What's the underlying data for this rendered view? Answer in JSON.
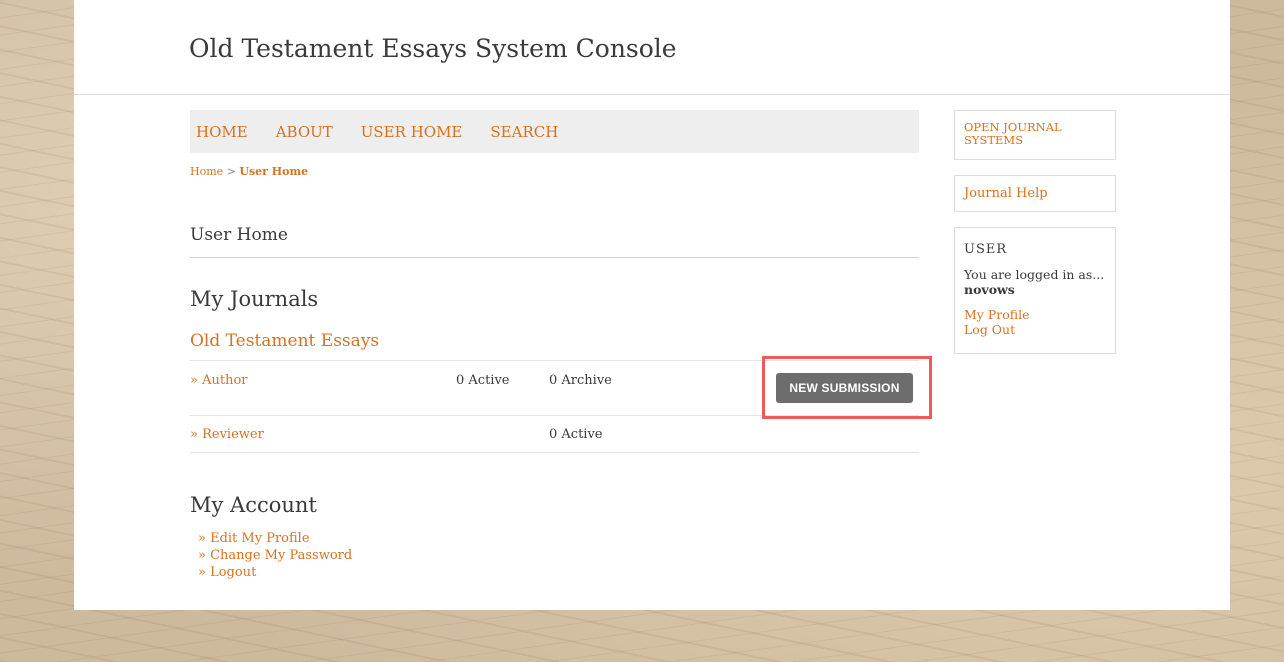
{
  "header": {
    "site_title": "Old Testament Essays System Console"
  },
  "nav": {
    "items": [
      "HOME",
      "ABOUT",
      "USER HOME",
      "SEARCH"
    ]
  },
  "breadcrumb": {
    "home": "Home",
    "separator": ">",
    "current": "User Home"
  },
  "page_title": "User Home",
  "my_journals": {
    "title": "My Journals",
    "journal_name": "Old Testament Essays",
    "roles": [
      {
        "label": "» Author",
        "active": "0 Active",
        "archive": "0 Archive",
        "action": "NEW SUBMISSION"
      },
      {
        "label": "» Reviewer",
        "active": "",
        "archive": "0 Active"
      }
    ]
  },
  "my_account": {
    "title": "My Account",
    "links": [
      "» Edit My Profile",
      "» Change My Password",
      "» Logout"
    ]
  },
  "sidebar": {
    "ojs_link": "OPEN JOURNAL SYSTEMS",
    "help_link": "Journal Help",
    "user_box": {
      "title": "USER",
      "logged_in_text": "You are logged in as...",
      "username": "novows",
      "links": [
        "My Profile",
        "Log Out"
      ]
    }
  },
  "colors": {
    "accent": "#d8711f",
    "text": "#3a3a3a",
    "button": "#6d6d6d",
    "highlight": "#ef5a5a"
  }
}
